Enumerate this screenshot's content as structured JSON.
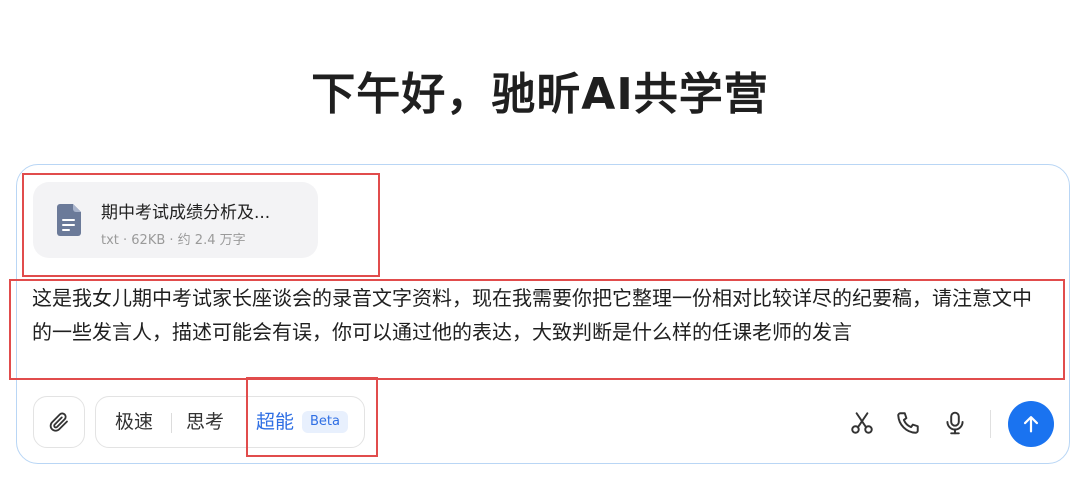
{
  "greeting": "下午好，驰昕AI共学营",
  "attachment": {
    "name": "期中考试成绩分析及...",
    "meta": "txt · 62KB · 约 2.4 万字",
    "icon": "document-icon"
  },
  "prompt": {
    "text": "这是我女儿期中考试家长座谈会的录音文字资料，现在我需要你把它整理一份相对比较详尽的纪要稿，请注意文中的一些发言人，描述可能会有误，你可以通过他的表达，大致判断是什么样的任课老师的发言"
  },
  "toolbar": {
    "attach_icon": "paperclip-icon",
    "modes": {
      "fast": "极速",
      "think": "思考",
      "super": "超能",
      "beta": "Beta"
    },
    "scissors_icon": "scissors-icon",
    "phone_icon": "phone-icon",
    "mic_icon": "microphone-icon",
    "send_icon": "arrow-up-icon"
  },
  "colors": {
    "accent": "#1a73f0",
    "selected_mode": "#2f6fe4",
    "highlight_box": "#e14c4c",
    "composer_border": "#b9d6f5"
  }
}
